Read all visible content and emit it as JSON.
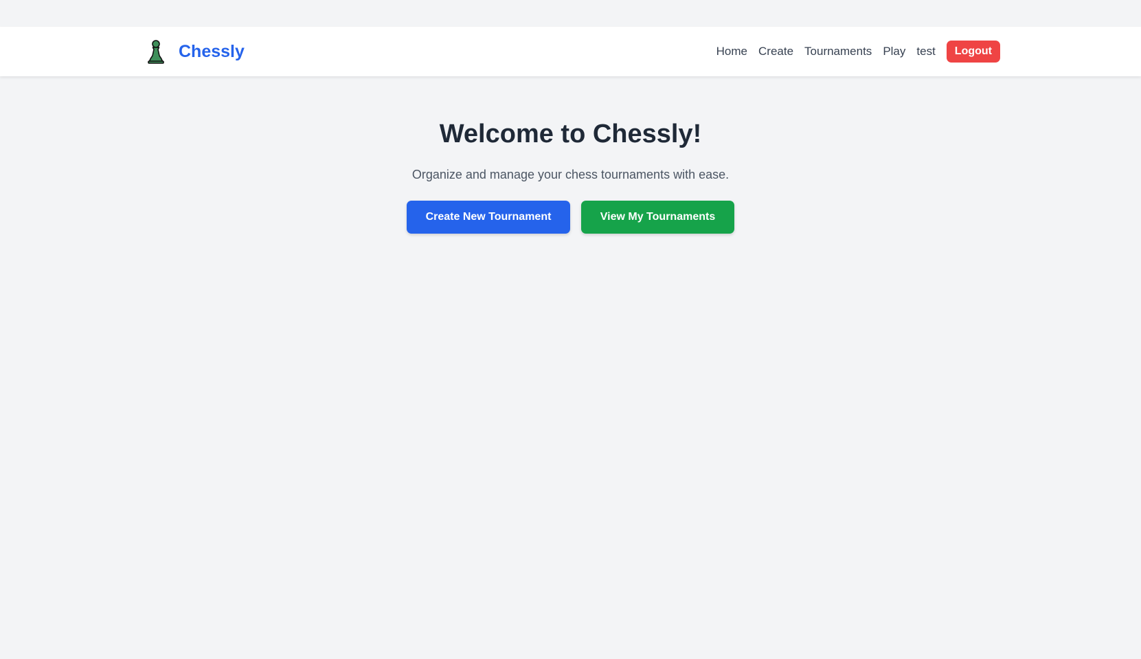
{
  "navbar": {
    "brand": {
      "name": "Chessly",
      "icon": "chess-pawn-icon",
      "icon_color": "#3f8f5a"
    },
    "links": [
      {
        "label": "Home"
      },
      {
        "label": "Create"
      },
      {
        "label": "Tournaments"
      },
      {
        "label": "Play"
      }
    ],
    "username": "test",
    "logout_label": "Logout"
  },
  "hero": {
    "title": "Welcome to Chessly!",
    "subtitle": "Organize and manage your chess tournaments with ease.",
    "primary_button": "Create New Tournament",
    "secondary_button": "View My Tournaments"
  },
  "colors": {
    "brand": "#2563eb",
    "primary_button": "#2563eb",
    "secondary_button": "#16a34a",
    "logout_button": "#ef4444",
    "background": "#f3f4f6"
  }
}
